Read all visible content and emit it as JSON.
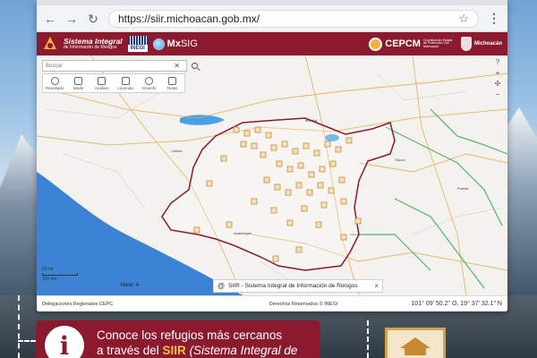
{
  "browser": {
    "url": "https://siir.michoacan.gob.mx/",
    "back_icon": "arrow-left-icon",
    "forward_icon": "arrow-right-icon",
    "reload_icon": "reload-icon"
  },
  "site_header": {
    "siir_title_1": "Sistema Integral",
    "siir_title_2": "de Información de Riesgos",
    "inegi": "INEGI",
    "mxsig_mx": "Mx",
    "mxsig_sig": "SIG",
    "cepcm": "CEPCM",
    "cepcm_sub": "Coordinación Estatal de Protección Civil Michoacán",
    "michoacan": "Michoacán",
    "brand_color": "#8b1a2e"
  },
  "map": {
    "search_placeholder": "Buscar",
    "tools": [
      {
        "label": "Resultado",
        "icon": "search-icon"
      },
      {
        "label": "Medir",
        "icon": "ruler-icon"
      },
      {
        "label": "Análisis",
        "icon": "analysis-icon"
      },
      {
        "label": "Leyenda",
        "icon": "legend-icon"
      },
      {
        "label": "Geoinfo",
        "icon": "globe-icon"
      },
      {
        "label": "Rutas",
        "icon": "route-icon"
      }
    ],
    "zoom_in": "+",
    "zoom_out": "−",
    "help": "?",
    "scale_top": "50 mi",
    "scale_bottom": "100 km",
    "nivel": "Nivel: 4",
    "credit": "SIIR - Sistema Integral de Información de Riesgos"
  },
  "statusbar": {
    "left": "Delegaciones Regionales CEPC",
    "mid": "Derechos Reservados © INEGI",
    "coords": "101° 09' 50.2\" O, 19° 37' 32.1\" N"
  },
  "banner": {
    "line1": "Conoce los refugios más cercanos",
    "line2_pre": "a través del ",
    "line2_hl": "SIIR",
    "line2_it": " (Sistema Integral de"
  }
}
